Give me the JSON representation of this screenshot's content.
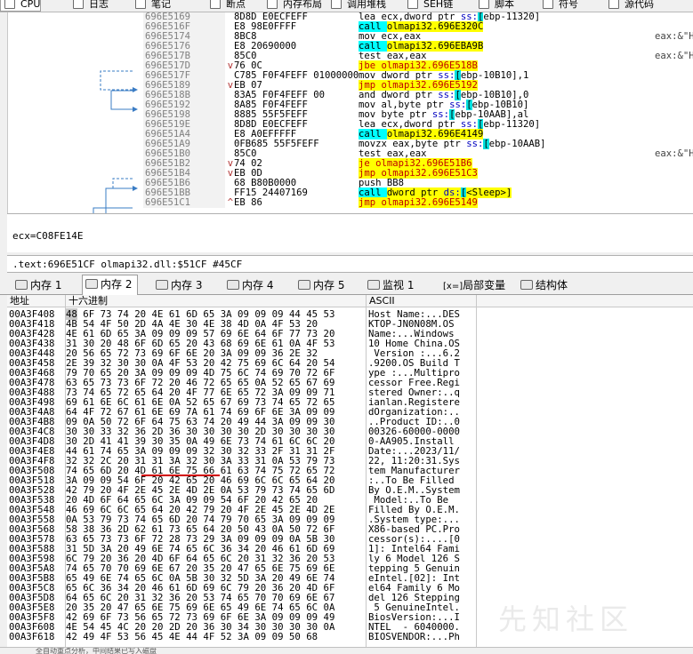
{
  "top_tabs": [
    {
      "label": "CPU",
      "icon": "cpu-icon",
      "active": true
    },
    {
      "label": "日志",
      "icon": "log-icon"
    },
    {
      "label": "笔记",
      "icon": "notes-icon"
    },
    {
      "label": "断点",
      "icon": "breakpoint-icon"
    },
    {
      "label": "内存布局",
      "icon": "memory-map-icon"
    },
    {
      "label": "调用堆栈",
      "icon": "call-stack-icon"
    },
    {
      "label": "SEH链",
      "icon": "seh-chain-icon"
    },
    {
      "label": "脚本",
      "icon": "script-icon"
    },
    {
      "label": "符号",
      "icon": "symbols-icon"
    },
    {
      "label": "源代码",
      "icon": "source-icon"
    }
  ],
  "disasm": [
    {
      "addr": "696E5169",
      "mark": "",
      "bytes": "8D8D E0ECFEFF",
      "instr": "lea ecx,dword ptr ss:[ebp-11320]",
      "comment": ""
    },
    {
      "addr": "696E516F",
      "mark": "",
      "bytes": "E8 98E0FFFF",
      "instr": "call olmapi32.696E320C",
      "comment": ""
    },
    {
      "addr": "696E5174",
      "mark": "",
      "bytes": "8BC8",
      "instr": "mov ecx,eax",
      "comment": "eax:&\"H"
    },
    {
      "addr": "696E5176",
      "mark": "",
      "bytes": "E8 20690000",
      "instr": "call olmapi32.696EBA9B",
      "comment": ""
    },
    {
      "addr": "696E517B",
      "mark": "",
      "bytes": "85C0",
      "instr": "test eax,eax",
      "comment": "eax:&\"H"
    },
    {
      "addr": "696E517D",
      "mark": "v",
      "bytes": "76 0C",
      "instr": "jbe olmapi32.696E518B",
      "comment": ""
    },
    {
      "addr": "696E517F",
      "mark": "",
      "bytes": "C785 F0F4FEFF 01000000",
      "instr": "mov dword ptr ss:[ebp-10B10],1",
      "comment": ""
    },
    {
      "addr": "696E5189",
      "mark": "v",
      "bytes": "EB 07",
      "instr": "jmp olmapi32.696E5192",
      "comment": ""
    },
    {
      "addr": "696E518B",
      "mark": "",
      "bytes": "83A5 F0F4FEFF 00",
      "instr": "and dword ptr ss:[ebp-10B10],0",
      "comment": ""
    },
    {
      "addr": "696E5192",
      "mark": "",
      "bytes": "8A85 F0F4FEFF",
      "instr": "mov al,byte ptr ss:[ebp-10B10]",
      "comment": ""
    },
    {
      "addr": "696E5198",
      "mark": "",
      "bytes": "8885 55F5FEFF",
      "instr": "mov byte ptr ss:[ebp-10AAB],al",
      "comment": ""
    },
    {
      "addr": "696E519E",
      "mark": "",
      "bytes": "8D8D E0ECFEFF",
      "instr": "lea ecx,dword ptr ss:[ebp-11320]",
      "comment": ""
    },
    {
      "addr": "696E51A4",
      "mark": "",
      "bytes": "E8 A0EFFFFF",
      "instr": "call olmapi32.696E4149",
      "comment": ""
    },
    {
      "addr": "696E51A9",
      "mark": "",
      "bytes": "0FB685 55F5FEFF",
      "instr": "movzx eax,byte ptr ss:[ebp-10AAB]",
      "comment": ""
    },
    {
      "addr": "696E51B0",
      "mark": "",
      "bytes": "85C0",
      "instr": "test eax,eax",
      "comment": "eax:&\"H"
    },
    {
      "addr": "696E51B2",
      "mark": "v",
      "bytes": "74 02",
      "instr": "je olmapi32.696E51B6",
      "comment": ""
    },
    {
      "addr": "696E51B4",
      "mark": "v",
      "bytes": "EB 0D",
      "instr": "jmp olmapi32.696E51C3",
      "comment": ""
    },
    {
      "addr": "696E51B6",
      "mark": "",
      "bytes": "68 B80B0000",
      "instr": "push BB8",
      "comment": ""
    },
    {
      "addr": "696E51BB",
      "mark": "",
      "bytes": "FF15 24407169",
      "instr": "call dword ptr ds:[<Sleep>]",
      "comment": ""
    },
    {
      "addr": "696E51C1",
      "mark": "^",
      "bytes": "EB 86",
      "instr": "jmp olmapi32.696E5149",
      "comment": ""
    }
  ],
  "info": {
    "line1": "ecx=C08FE14E",
    "line2": ".text:696E51CF olmapi32.dll:$51CF #45CF"
  },
  "bottom_tabs": [
    {
      "label": "内存 1",
      "icon": "memory-icon"
    },
    {
      "label": "内存 2",
      "icon": "memory-icon",
      "active": true
    },
    {
      "label": "内存 3",
      "icon": "memory-icon"
    },
    {
      "label": "内存 4",
      "icon": "memory-icon"
    },
    {
      "label": "内存 5",
      "icon": "memory-icon"
    },
    {
      "label": "监视 1",
      "icon": "watch-icon"
    },
    {
      "label": "局部变量",
      "icon": "locals-icon",
      "prefix": "[x=]"
    },
    {
      "label": "结构体",
      "icon": "struct-icon"
    }
  ],
  "dump_headers": {
    "addr": "地址",
    "hex": "十六进制",
    "ascii": "ASCII"
  },
  "dump": [
    {
      "addr": "00A3F408",
      "hex": "48 6F 73 74 20 4E 61 6D 65 3A 09 09 09 44 45 53",
      "ascii": "Host Name:...DES"
    },
    {
      "addr": "00A3F418",
      "hex": "4B 54 4F 50 2D 4A 4E 30 4E 38 4D 0A 4F 53 20",
      "ascii": "KTOP-JN0N08M.OS "
    },
    {
      "addr": "00A3F428",
      "hex": "4E 61 6D 65 3A 09 09 09 57 69 6E 64 6F 77 73 20",
      "ascii": "Name:...Windows "
    },
    {
      "addr": "00A3F438",
      "hex": "31 30 20 48 6F 6D 65 20 43 68 69 6E 61 0A 4F 53",
      "ascii": "10 Home China.OS"
    },
    {
      "addr": "00A3F448",
      "hex": "20 56 65 72 73 69 6F 6E 20 3A 09 09 36 2E 32",
      "ascii": " Version :...6.2"
    },
    {
      "addr": "00A3F458",
      "hex": "2E 39 32 30 30 0A 4F 53 20 42 75 69 6C 64 20 54",
      "ascii": ".9200.OS Build T"
    },
    {
      "addr": "00A3F468",
      "hex": "79 70 65 20 3A 09 09 09 4D 75 6C 74 69 70 72 6F",
      "ascii": "ype :...Multipro"
    },
    {
      "addr": "00A3F478",
      "hex": "63 65 73 73 6F 72 20 46 72 65 65 0A 52 65 67 69",
      "ascii": "cessor Free.Regi"
    },
    {
      "addr": "00A3F488",
      "hex": "73 74 65 72 65 64 20 4F 77 6E 65 72 3A 09 09 71",
      "ascii": "stered Owner:..q"
    },
    {
      "addr": "00A3F498",
      "hex": "69 61 6E 6C 61 6E 0A 52 65 67 69 73 74 65 72 65",
      "ascii": "ianlan.Registere"
    },
    {
      "addr": "00A3F4A8",
      "hex": "64 4F 72 67 61 6E 69 7A 61 74 69 6F 6E 3A 09 09",
      "ascii": "dOrganization:.."
    },
    {
      "addr": "00A3F4B8",
      "hex": "09 0A 50 72 6F 64 75 63 74 20 49 44 3A 09 09 30",
      "ascii": "..Product ID:..0"
    },
    {
      "addr": "00A3F4C8",
      "hex": "30 30 33 32 36 2D 36 30 30 30 30 2D 30 30 30 30",
      "ascii": "00326-60000-0000"
    },
    {
      "addr": "00A3F4D8",
      "hex": "30 2D 41 41 39 30 35 0A 49 6E 73 74 61 6C 6C 20",
      "ascii": "0-AA905.Install "
    },
    {
      "addr": "00A3F4E8",
      "hex": "44 61 74 65 3A 09 09 09 32 30 32 33 2F 31 31 2F",
      "ascii": "Date:...2023/11/"
    },
    {
      "addr": "00A3F4F8",
      "hex": "32 32 2C 20 31 31 3A 32 30 3A 33 31 0A 53 79 73",
      "ascii": "22, 11:20:31.Sys"
    },
    {
      "addr": "00A3F508",
      "hex": "74 65 6D 20 4D 61 6E 75 66 61 63 74 75 72 65 72",
      "ascii": "tem Manufacturer"
    },
    {
      "addr": "00A3F518",
      "hex": "3A 09 09 54 6F 20 42 65 20 46 69 6C 6C 65 64 20",
      "ascii": ":..To Be Filled "
    },
    {
      "addr": "00A3F528",
      "hex": "42 79 20 4F 2E 45 2E 4D 2E 0A 53 79 73 74 65 6D",
      "ascii": "By O.E.M..System"
    },
    {
      "addr": "00A3F538",
      "hex": "20 4D 6F 64 65 6C 3A 09 09 54 6F 20 42 65 20",
      "ascii": " Model:..To Be "
    },
    {
      "addr": "00A3F548",
      "hex": "46 69 6C 6C 65 64 20 42 79 20 4F 2E 45 2E 4D 2E",
      "ascii": "Filled By O.E.M."
    },
    {
      "addr": "00A3F558",
      "hex": "0A 53 79 73 74 65 6D 20 74 79 70 65 3A 09 09 09",
      "ascii": ".System type:..."
    },
    {
      "addr": "00A3F568",
      "hex": "58 38 36 2D 62 61 73 65 64 20 50 43 0A 50 72 6F",
      "ascii": "X86-based PC.Pro"
    },
    {
      "addr": "00A3F578",
      "hex": "63 65 73 73 6F 72 28 73 29 3A 09 09 09 0A 5B 30",
      "ascii": "cessor(s):....[0"
    },
    {
      "addr": "00A3F588",
      "hex": "31 5D 3A 20 49 6E 74 65 6C 36 34 20 46 61 6D 69",
      "ascii": "1]: Intel64 Fami"
    },
    {
      "addr": "00A3F598",
      "hex": "6C 79 20 36 20 4D 6F 64 65 6C 20 31 32 36 20 53",
      "ascii": "ly 6 Model 126 S"
    },
    {
      "addr": "00A3F5A8",
      "hex": "74 65 70 70 69 6E 67 20 35 20 47 65 6E 75 69 6E",
      "ascii": "tepping 5 Genuin"
    },
    {
      "addr": "00A3F5B8",
      "hex": "65 49 6E 74 65 6C 0A 5B 30 32 5D 3A 20 49 6E 74",
      "ascii": "eIntel.[02]: Int"
    },
    {
      "addr": "00A3F5C8",
      "hex": "65 6C 36 34 20 46 61 6D 69 6C 79 20 36 20 4D 6F",
      "ascii": "el64 Family 6 Mo"
    },
    {
      "addr": "00A3F5D8",
      "hex": "64 65 6C 20 31 32 36 20 53 74 65 70 70 69 6E 67",
      "ascii": "del 126 Stepping"
    },
    {
      "addr": "00A3F5E8",
      "hex": "20 35 20 47 65 6E 75 69 6E 65 49 6E 74 65 6C 0A",
      "ascii": " 5 GenuineIntel."
    },
    {
      "addr": "00A3F5F8",
      "hex": "42 69 6F 73 56 65 72 73 69 6F 6E 3A 09 09 09 49",
      "ascii": "BiosVersion:...I"
    },
    {
      "addr": "00A3F608",
      "hex": "4E 54 45 4C 20 20 2D 20 36 30 34 30 30 30 30 0A",
      "ascii": "NTEL  - 6040000."
    },
    {
      "addr": "00A3F618",
      "hex": "42 49 4F 53 56 45 4E 44 4F 52 3A 09 09 50 68",
      "ascii": "BIOSVENDOR:...Ph"
    }
  ],
  "watermark": "先知社区",
  "status_text": "全自动重点分析，中间结果已写入磁盘"
}
